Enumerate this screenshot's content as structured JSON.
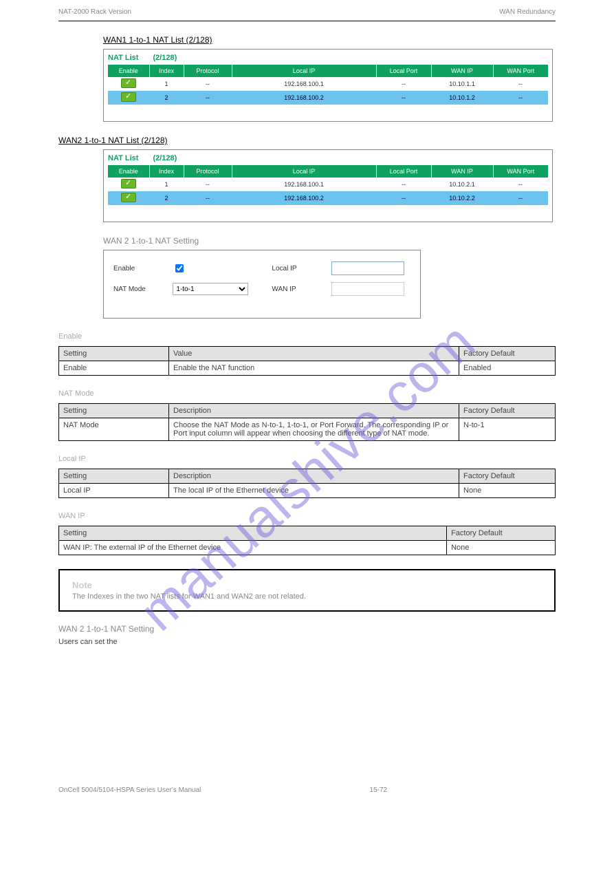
{
  "header": {
    "left": "NAT-2000 Rack Version",
    "right": "WAN Redundancy"
  },
  "sections": {
    "wan1_title": "WAN1 1-to-1 NAT List (2/128)",
    "wan2_title": "WAN2 1-to-1 NAT List (2/128)"
  },
  "nat_list_label": "NAT List",
  "nat_list_count": "(2/128)",
  "nat_headers": [
    "Enable",
    "Index",
    "Protocol",
    "Local IP",
    "Local Port",
    "WAN IP",
    "WAN Port"
  ],
  "wan1_rows": [
    {
      "index": "1",
      "protocol": "--",
      "local_ip": "192.168.100.1",
      "local_port": "--",
      "wan_ip": "10.10.1.1",
      "wan_port": "--"
    },
    {
      "index": "2",
      "protocol": "--",
      "local_ip": "192.168.100.2",
      "local_port": "--",
      "wan_ip": "10.10.1.2",
      "wan_port": "--"
    }
  ],
  "wan2_rows": [
    {
      "index": "1",
      "protocol": "--",
      "local_ip": "192.168.100.1",
      "local_port": "--",
      "wan_ip": "10.10.2.1",
      "wan_port": "--"
    },
    {
      "index": "2",
      "protocol": "--",
      "local_ip": "192.168.100.2",
      "local_port": "--",
      "wan_ip": "10.10.2.2",
      "wan_port": "--"
    }
  ],
  "wan2_settings_title": "WAN 2 1-to-1 NAT Setting",
  "settings": {
    "enable_label": "Enable",
    "nat_mode_label": "NAT Mode",
    "nat_mode_value": "1-to-1",
    "local_ip_label": "Local IP",
    "wan_ip_label": "WAN IP"
  },
  "spec1": {
    "head": [
      "Setting",
      "Value",
      "Factory Default"
    ],
    "row": {
      "setting": "Enable",
      "value": "Enable the NAT function",
      "default": "Enabled"
    }
  },
  "spec2": {
    "head": [
      "Setting",
      "Description",
      "Factory Default"
    ],
    "row": {
      "setting": "NAT Mode",
      "value": "Choose the NAT Mode as N-to-1, 1-to-1, or Port Forward. The corresponding IP or Port input column will appear when choosing the different type of NAT mode.",
      "default": "N-to-1"
    }
  },
  "spec3": {
    "head": [
      "Setting",
      "Description",
      "Factory Default"
    ],
    "row": {
      "setting": "Local IP",
      "value": "The local IP of the Ethernet device",
      "default": "None"
    }
  },
  "spec4": {
    "head": [
      "Setting",
      "Factory Default"
    ],
    "row": {
      "setting": "WAN IP: The external IP of the Ethernet device",
      "default": "None"
    }
  },
  "note": "Note",
  "note_text": "The Indexes in the two NAT lists for WAN1 and WAN2 are not related.",
  "duplicate_heading": "WAN 2 1-to-1 NAT Setting",
  "duplicate_text": "Users can set the",
  "footer": {
    "left": "OnCell 5004/5104-HSPA Series User's Manual",
    "page": "15-72",
    "right": ""
  },
  "watermark": "manualshive.com"
}
